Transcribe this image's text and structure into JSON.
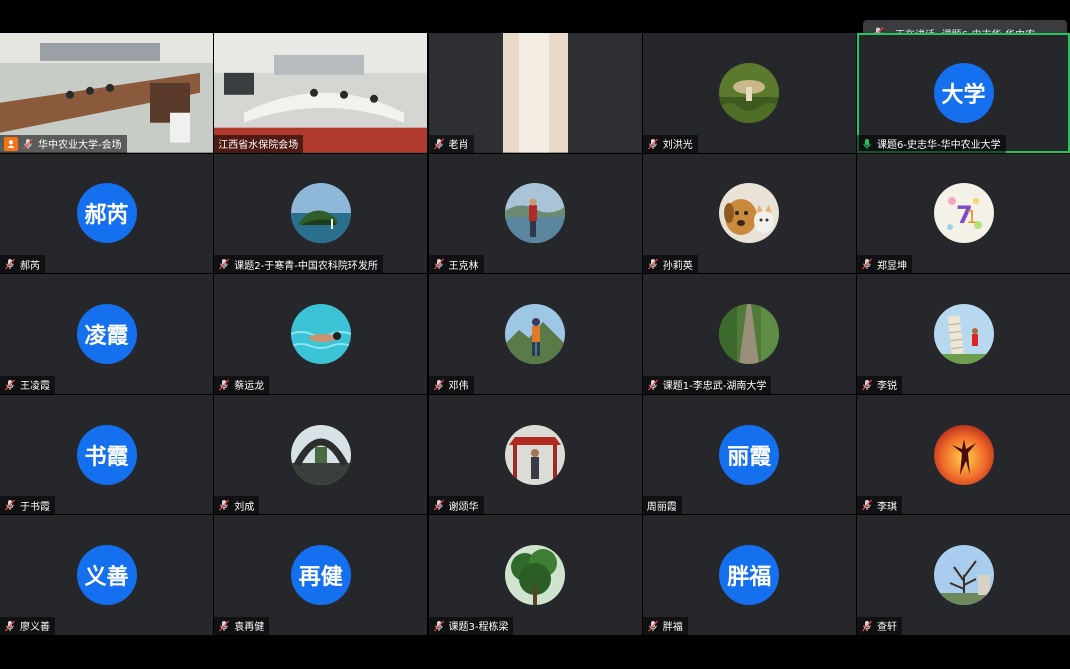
{
  "speaking_indicator": {
    "prefix": "正在讲话:",
    "speaker": "课题6-史志华-华中农…"
  },
  "participants": [
    {
      "name": "华中农业大学-会场",
      "kind": "video-room",
      "host": true,
      "mic": "muted"
    },
    {
      "name": "江西省水保院会场",
      "kind": "video-room2",
      "mic": "none"
    },
    {
      "name": "老肖",
      "kind": "video-door",
      "mic": "muted"
    },
    {
      "name": "刘洪光",
      "kind": "photo",
      "icon": "mushroom-photo",
      "mic": "muted"
    },
    {
      "name": "课题6-史志华-华中农业大学",
      "kind": "text",
      "avatar": "大学",
      "mic": "active",
      "active": true
    },
    {
      "name": "郝芮",
      "kind": "text",
      "avatar": "郝芮",
      "mic": "muted"
    },
    {
      "name": "课题2-于寒青-中国农科院环发所",
      "kind": "photo",
      "icon": "coast-photo",
      "mic": "muted"
    },
    {
      "name": "王克林",
      "kind": "photo",
      "icon": "lake-person-photo",
      "mic": "muted"
    },
    {
      "name": "孙莉英",
      "kind": "photo",
      "icon": "dog-cat-photo",
      "mic": "muted"
    },
    {
      "name": "郑昱坤",
      "kind": "photo",
      "icon": "floral-number-photo",
      "mic": "muted"
    },
    {
      "name": "王凌霞",
      "kind": "text",
      "avatar": "凌霞",
      "mic": "muted"
    },
    {
      "name": "蔡运龙",
      "kind": "photo",
      "icon": "swimmer-photo",
      "mic": "muted"
    },
    {
      "name": "邓伟",
      "kind": "photo",
      "icon": "hiker-photo",
      "mic": "muted"
    },
    {
      "name": "课题1-李忠武-湖南大学",
      "kind": "photo",
      "icon": "path-photo",
      "mic": "muted"
    },
    {
      "name": "李锐",
      "kind": "photo",
      "icon": "pisa-photo",
      "mic": "muted"
    },
    {
      "name": "于书霞",
      "kind": "text",
      "avatar": "书霞",
      "mic": "muted"
    },
    {
      "name": "刘成",
      "kind": "photo",
      "icon": "arch-photo",
      "mic": "muted"
    },
    {
      "name": "谢颂华",
      "kind": "photo",
      "icon": "pavilion-photo",
      "mic": "muted"
    },
    {
      "name": "周丽霞",
      "kind": "text",
      "avatar": "丽霞",
      "mic": "none"
    },
    {
      "name": "李琪",
      "kind": "photo",
      "icon": "dancer-photo",
      "mic": "muted"
    },
    {
      "name": "廖义善",
      "kind": "text",
      "avatar": "义善",
      "mic": "muted"
    },
    {
      "name": "袁再健",
      "kind": "text",
      "avatar": "再健",
      "mic": "muted"
    },
    {
      "name": "课题3-程栋梁",
      "kind": "photo",
      "icon": "tree-photo",
      "mic": "muted"
    },
    {
      "name": "胖福",
      "kind": "text",
      "avatar": "胖福",
      "mic": "muted"
    },
    {
      "name": "查轩",
      "kind": "photo",
      "icon": "bare-tree-photo",
      "mic": "muted"
    }
  ],
  "colors": {
    "tile_bg": "#26272b",
    "avatar_blue": "#1570ef",
    "active_border": "#22c55e",
    "muted_red": "#ef4444",
    "host_orange": "#f97316"
  }
}
